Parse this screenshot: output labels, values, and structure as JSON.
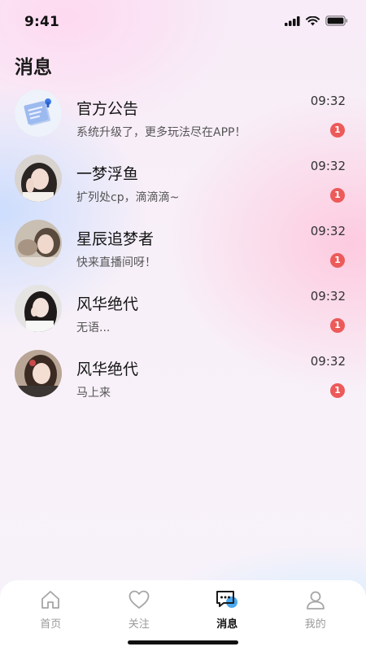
{
  "status_bar": {
    "time": "9:41"
  },
  "page": {
    "title": "消息"
  },
  "messages": [
    {
      "name": "官方公告",
      "preview": "系统升级了，更多玩法尽在APP！",
      "time": "09:32",
      "unread": "1",
      "avatar": "announcement-note-icon"
    },
    {
      "name": "一梦浮鱼",
      "preview": "扩列处cp，滴滴滴~",
      "time": "09:32",
      "unread": "1",
      "avatar": "user-photo"
    },
    {
      "name": "星辰追梦者",
      "preview": "快来直播间呀！",
      "time": "09:32",
      "unread": "1",
      "avatar": "user-photo"
    },
    {
      "name": "风华绝代",
      "preview": "无语...",
      "time": "09:32",
      "unread": "1",
      "avatar": "user-photo"
    },
    {
      "name": "风华绝代",
      "preview": "马上来",
      "time": "09:32",
      "unread": "1",
      "avatar": "user-photo"
    }
  ],
  "tab_bar": {
    "items": [
      {
        "label": "首页",
        "icon": "home-icon",
        "active": false
      },
      {
        "label": "关注",
        "icon": "heart-icon",
        "active": false
      },
      {
        "label": "消息",
        "icon": "chat-bubble-icon",
        "active": true
      },
      {
        "label": "我的",
        "icon": "user-icon",
        "active": false
      }
    ]
  },
  "colors": {
    "badge": "#ec5a5a",
    "tab_active": "#111111",
    "tab_inactive": "#9a9a9a",
    "accent_blue": "#4aa8f0"
  }
}
